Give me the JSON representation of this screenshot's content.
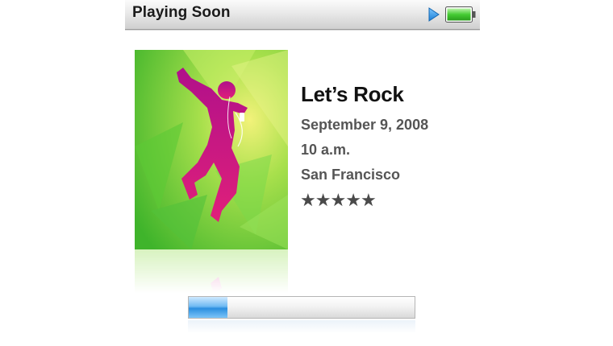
{
  "header": {
    "title": "Playing Soon",
    "play_icon": "play-arrow-icon",
    "battery_icon": "battery-full-icon",
    "accent_blue": "#2a8ee6",
    "battery_green": "#39c12b"
  },
  "event": {
    "title": "Let’s Rock",
    "date": "September 9, 2008",
    "time": "10 a.m.",
    "location": "San Francisco",
    "rating_stars": [
      "★",
      "★",
      "★",
      "★",
      "★"
    ],
    "rating_value": 5,
    "rating_max": 5
  },
  "album_art": {
    "icon": "dancing-silhouette-artwork",
    "background_color": "#7ed43a",
    "silhouette_color": "#d0187f"
  },
  "progress": {
    "fraction": 0.17,
    "fill_color": "#3d9ae8"
  }
}
